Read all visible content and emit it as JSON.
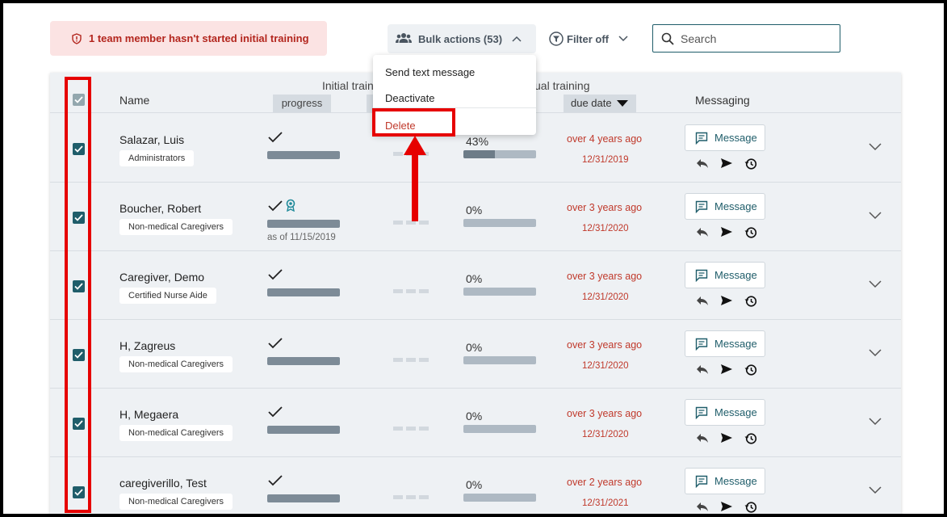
{
  "alert": {
    "text": "1 team member hasn't started initial training"
  },
  "toolbar": {
    "bulk_actions_label": "Bulk actions (53)",
    "filter_label": "Filter off",
    "search_placeholder": "Search"
  },
  "bulk_menu": {
    "items": [
      "Send text message",
      "Deactivate",
      "Delete"
    ]
  },
  "table": {
    "headers": {
      "name": "Name",
      "initial_training": "Initial train",
      "annual_training": "ual training",
      "progress": "progress",
      "due_date": "due date",
      "messaging": "Messaging"
    },
    "message_button_label": "Message",
    "rows": [
      {
        "name": "Salazar, Luis",
        "role": "Administrators",
        "initial_complete": true,
        "award": false,
        "as_of": "",
        "annual_percent": "43%",
        "annual_fraction": 0.43,
        "overdue": "over 4 years ago",
        "due_date": "12/31/2019"
      },
      {
        "name": "Boucher, Robert",
        "role": "Non-medical Caregivers",
        "initial_complete": true,
        "award": true,
        "as_of": "as of 11/15/2019",
        "annual_percent": "0%",
        "annual_fraction": 0,
        "overdue": "over 3 years ago",
        "due_date": "12/31/2020"
      },
      {
        "name": "Caregiver, Demo",
        "role": "Certified Nurse Aide",
        "initial_complete": true,
        "award": false,
        "as_of": "",
        "annual_percent": "0%",
        "annual_fraction": 0,
        "overdue": "over 3 years ago",
        "due_date": "12/31/2020"
      },
      {
        "name": "H, Zagreus",
        "role": "Non-medical Caregivers",
        "initial_complete": true,
        "award": false,
        "as_of": "",
        "annual_percent": "0%",
        "annual_fraction": 0,
        "overdue": "over 3 years ago",
        "due_date": "12/31/2020"
      },
      {
        "name": "H, Megaera",
        "role": "Non-medical Caregivers",
        "initial_complete": true,
        "award": false,
        "as_of": "",
        "annual_percent": "0%",
        "annual_fraction": 0,
        "overdue": "over 3 years ago",
        "due_date": "12/31/2020"
      },
      {
        "name": "caregiverillo, Test",
        "role": "Non-medical Caregivers",
        "initial_complete": true,
        "award": false,
        "as_of": "",
        "annual_percent": "0%",
        "annual_fraction": 0,
        "overdue": "over 2 years ago",
        "due_date": "12/31/2021"
      }
    ]
  },
  "colors": {
    "accent": "#1f5d6a",
    "overdue": "#c0392b",
    "annotation": "#e60000",
    "alert_bg": "#fbe3e3"
  }
}
